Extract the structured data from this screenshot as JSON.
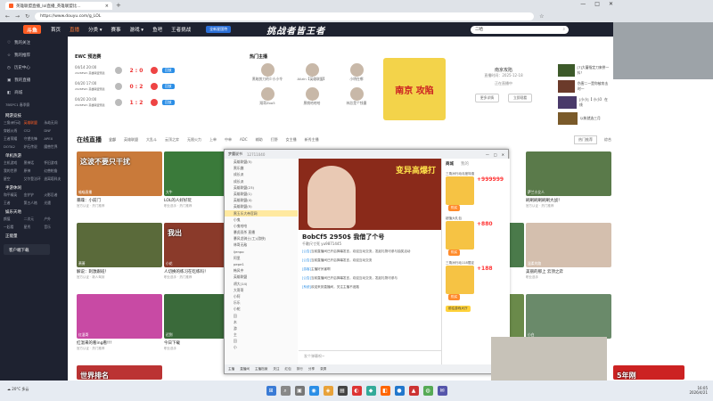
{
  "browser": {
    "tab_title": "英雄联盟直播_lol直播_英雄联盟比...",
    "url": "https://www.douyu.com/g_LOL",
    "tab_close": "×",
    "new_tab": "+",
    "win_min": "—",
    "win_max": "□",
    "win_close": "✕"
  },
  "topnav": {
    "logo": "斗鱼",
    "items": [
      "首页",
      "直播",
      "分类 ▾",
      "赛事",
      "游戏 ▾",
      "鱼吧",
      "王者挑战"
    ],
    "banner": "全新星国特",
    "headline": "挑战者皆王者",
    "search_placeholder": "二哈"
  },
  "sidebar": {
    "items": [
      "我的关注",
      "我的推荐",
      "历史中心",
      "我的直播",
      "商城"
    ],
    "tiny": "7BSPC1 春季赛",
    "section1": "网游竞技",
    "grid1": [
      "三角洲行动",
      "英雄联盟",
      "永劫无间",
      "穿越火线",
      "CS2",
      "DNF",
      "王者荣耀",
      "守望先锋",
      "APEX",
      "DOTA2",
      "炉石传说",
      "魔兽世界"
    ],
    "section2": "单机热游",
    "grid2": [
      "主机游戏",
      "黑神话",
      "怀旧游戏",
      "我的世界",
      "原神",
      "幻兽帕鲁",
      "星空",
      "艾尔登法环",
      "逃离塔科夫"
    ],
    "section3": "手游休闲",
    "grid3": [
      "和平精英",
      "金铲铲",
      "火影忍者",
      "王者",
      "第五人格",
      "光遇"
    ],
    "section4": "娱乐天地",
    "grid4": [
      "颜值",
      "二次元",
      "户外",
      "一起看",
      "星秀",
      "音乐"
    ],
    "section5": "正能量",
    "download": "客户端下载"
  },
  "ewc": {
    "title": "EWC 预选赛",
    "matches": [
      {
        "date": "04/14 20:00",
        "league": "2026EWC 英雄联盟预选",
        "score": "2 : 0",
        "btn": "回放"
      },
      {
        "date": "04/20 17:00",
        "league": "2026EWC 英雄联盟预选",
        "score": "0 : 2",
        "btn": "回放"
      },
      {
        "date": "04/20 20:00",
        "league": "2026EWC 英雄联盟预选",
        "score": "1 : 2",
        "btn": "回放"
      }
    ]
  },
  "hot": {
    "title": "热门主播",
    "anchors": [
      "黑暗剪刀的少小小令",
      "Alizin【英雄联盟】",
      "小明在哪",
      "翔哥Zoo5",
      "黑桃哈哈哈",
      "林总是个钱墨"
    ]
  },
  "promo": {
    "text": "南京 攻陷"
  },
  "info": {
    "title": "南京攻陷",
    "sub": "直播时间：2025-12-18",
    "rank": "正在直播中",
    "btn1": "更多详情",
    "btn2": "立即观看"
  },
  "right_panel": {
    "item1": "[7]大蘑指定刀来拼一抖！",
    "item2": "伤害二一是你被攻击时一",
    "item3": "[小小]【 小小】 在线",
    "item4": "以帐就选三月"
  },
  "live": {
    "title": "在线直播",
    "filters": [
      "全部",
      "英雄联盟",
      "大乱斗",
      "云顶之弈",
      "无限火力",
      "上单",
      "中单",
      "ADC",
      "辅助",
      "打野",
      "女主播",
      "新秀主播"
    ],
    "toggle": "热门推荐",
    "sort": "综合"
  },
  "cards": [
    {
      "title": "暴躁：小前门",
      "tags": "官方认证 · 热门推荐",
      "name": "喵喵直播",
      "banner": "这波不要只干扰"
    },
    {
      "title": "LOL的人好好玩",
      "tags": "职业选手 · 热门推荐",
      "name": "大牛",
      "banner": ""
    },
    {
      "title": "解说：刺激跟班！",
      "tags": "官方认证 · 新人驾到",
      "name": "萧萧",
      "banner": ""
    },
    {
      "title": "小鱼马术",
      "tags": "职业选手",
      "name": "蓝色",
      "banner": ""
    },
    {
      "title": "刷刷刷刷刷刷大战！",
      "tags": "官方认证 · 热门推荐",
      "name": "萨兰小艾人",
      "banner": ""
    },
    {
      "title": "不错好打的晚上好",
      "tags": "职业选手",
      "name": "艾比蒙哈哈",
      "banner": ""
    },
    {
      "title": "萨刻刻的好之三小迎回",
      "tags": "官方认证 · 热门推荐",
      "name": "叮叮叮",
      "banner": ""
    },
    {
      "title": "人切换的练习在吃练吗！",
      "tags": "职业选手 · 热门推荐",
      "name": "小花",
      "banner": "我出"
    },
    {
      "title": "小马的游戏",
      "tags": "官方认证",
      "name": "超人",
      "banner": ""
    },
    {
      "title": "美丽的那上 云顶之弈",
      "tags": "职业选手",
      "name": "温柔的路",
      "banner": ""
    },
    {
      "title": "6点开启直播",
      "tags": "职业选手 · 热门推荐",
      "name": "好到他明",
      "banner": ""
    },
    {
      "title": "红温来的看ing看!!!",
      "tags": "官方认证 · 热门推荐",
      "name": "红温哥",
      "banner": ""
    },
    {
      "title": "今日下载",
      "tags": "职业选手",
      "name": "迟到",
      "banner": ""
    },
    {
      "title": "看看这个",
      "tags": "新人",
      "name": "无敌",
      "banner": ""
    },
    {
      "title": "晚上好",
      "tags": "官方认证",
      "name": "小白",
      "banner": ""
    },
    {
      "title": "不好打",
      "tags": "职业选手",
      "name": "MQ一 满满的",
      "banner": ""
    },
    {
      "title": "冲冲冲",
      "tags": "热门推荐",
      "name": "7K风风",
      "banner": ""
    },
    {
      "title": "世界排名",
      "tags": "",
      "name": "",
      "banner": "世界排名"
    },
    {
      "title": "5年刚",
      "tags": "",
      "name": "",
      "banner": "5年刚"
    }
  ],
  "popup": {
    "room": "梦魔说书",
    "id": "12711040",
    "list": [
      "英雄联盟(5)",
      "黑乐趣",
      "成长派",
      "成长派",
      "英雄联盟(23)",
      "英雄联盟(1)",
      "英雄联盟(4)",
      "英雄联盟(5)",
      "黑玉乐大帝官网",
      "小鬼",
      "小鬼哈哈",
      "暴虎双杀 直播",
      "暴风龙骑士(工)(游侠)",
      "林哥无敌",
      "ijenpo",
      "阿里",
      "pepe1",
      "韩风中",
      "英雄联盟",
      "胡大(14)",
      "大哥哥",
      "小阿",
      "乐乐",
      "小蛇",
      "回",
      "木",
      "游",
      "主",
      "回",
      "小"
    ],
    "selected": "黑玉乐大帝官网",
    "img_text": "变异高爆打",
    "title": "BobCf5 2950$ 我借了个号",
    "subtitle": "千歌尺寸死 yu9871445",
    "chat": [
      {
        "n": "[公告]",
        "t": "当前直播间已开启弹幕发言，欢迎互动交流，发起礼物可参与抽奖活动"
      },
      {
        "n": "[公告]",
        "t": "当前直播间已开启弹幕发言，欢迎互动交流"
      },
      {
        "n": "[游客]",
        "t": "主播好厉害啊"
      },
      {
        "n": "[公告]",
        "t": "当前直播间已开启弹幕发言，欢迎互动交流，发起礼物可参与"
      },
      {
        "n": "[系统]",
        "t": "欢迎来到直播间，关注主播不迷路"
      }
    ],
    "input": "发个弹幕呗~",
    "shop_tabs": [
      "商城",
      "我的"
    ],
    "shop": [
      {
        "name": "三角洲行动月度特惠",
        "price": "+999999",
        "btn": "购买"
      },
      {
        "name": "超值大礼包",
        "price": "+880",
        "btn": "购买"
      },
      {
        "name": "三角洲行动118限定",
        "price": "+188",
        "btn": "购买"
      }
    ],
    "shop_more": "前往游戏大厅",
    "bottom": [
      "主播",
      "直播间",
      "主播档案",
      "关注",
      "红包",
      "排行",
      "分享",
      "录屏"
    ]
  },
  "taskbar": {
    "weather": "☁ 20°C 多云",
    "time": "16:05",
    "date": "2026/4/21",
    "apps": [
      "⊞",
      "⌕",
      "▣",
      "◉",
      "◈",
      "▤",
      "◐",
      "◆",
      "◧",
      "●",
      "▲",
      "◍",
      "✉"
    ]
  }
}
